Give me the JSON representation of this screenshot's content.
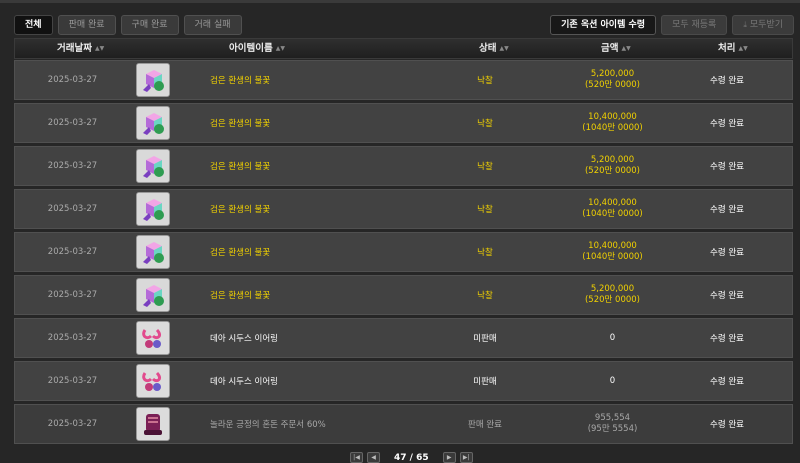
{
  "tabs": [
    {
      "label": "전체",
      "active": true
    },
    {
      "label": "판매 완료",
      "active": false
    },
    {
      "label": "구매 완료",
      "active": false
    },
    {
      "label": "거래 실패",
      "active": false
    }
  ],
  "actions": {
    "receive_label": "기존 옥션 아이템 수령",
    "relist_label": "모두 재등록",
    "receive_all_label": "모두받기",
    "receive_all_icon": "download-icon"
  },
  "columns": {
    "date": "거래날짜",
    "item": "아이템이름",
    "status": "상태",
    "price": "금액",
    "process": "처리"
  },
  "rows": [
    {
      "date": "2025-03-27",
      "icon": "cube-icon",
      "name": "검은 환생의 불꽃",
      "status": "낙찰",
      "price": "5,200,000",
      "price_sub": "(520만 0000)",
      "process": "수령 완료",
      "name_color": "#f1d100"
    },
    {
      "date": "2025-03-27",
      "icon": "cube-icon",
      "name": "검은 환생의 불꽃",
      "status": "낙찰",
      "price": "10,400,000",
      "price_sub": "(1040만 0000)",
      "process": "수령 완료",
      "name_color": "#f1d100"
    },
    {
      "date": "2025-03-27",
      "icon": "cube-icon",
      "name": "검은 환생의 불꽃",
      "status": "낙찰",
      "price": "5,200,000",
      "price_sub": "(520만 0000)",
      "process": "수령 완료",
      "name_color": "#f1d100"
    },
    {
      "date": "2025-03-27",
      "icon": "cube-icon",
      "name": "검은 환생의 불꽃",
      "status": "낙찰",
      "price": "10,400,000",
      "price_sub": "(1040만 0000)",
      "process": "수령 완료",
      "name_color": "#f1d100"
    },
    {
      "date": "2025-03-27",
      "icon": "cube-icon",
      "name": "검은 환생의 불꽃",
      "status": "낙찰",
      "price": "10,400,000",
      "price_sub": "(1040만 0000)",
      "process": "수령 완료",
      "name_color": "#f1d100"
    },
    {
      "date": "2025-03-27",
      "icon": "cube-icon",
      "name": "검은 환생의 불꽃",
      "status": "낙찰",
      "price": "5,200,000",
      "price_sub": "(520만 0000)",
      "process": "수령 완료",
      "name_color": "#f1d100"
    },
    {
      "date": "2025-03-27",
      "icon": "earring-icon",
      "name": "데아 시두스 이어링",
      "status": "미판매",
      "price": "0",
      "price_sub": "",
      "process": "수령 완료",
      "name_color": "#ffffff"
    },
    {
      "date": "2025-03-27",
      "icon": "earring-icon",
      "name": "데아 시두스 이어링",
      "status": "미판매",
      "price": "0",
      "price_sub": "",
      "process": "수령 완료",
      "name_color": "#ffffff"
    },
    {
      "date": "2025-03-27",
      "icon": "scroll-icon",
      "name": "놀라운 긍정의 혼돈 주문서 60%",
      "status": "판매 완료",
      "price": "955,554",
      "price_sub": "(95만 5554)",
      "process": "수령 완료",
      "name_color": "#a8a8a8"
    }
  ],
  "pager": {
    "first_icon": "first-page-icon",
    "prev_icon": "prev-page-icon",
    "current": "47",
    "separator": "/",
    "total": "65",
    "next_icon": "next-page-icon",
    "last_icon": "last-page-icon"
  },
  "colors": {
    "accent_yellow": "#f1d100",
    "background": "#262626",
    "row_bg": "#424242"
  }
}
